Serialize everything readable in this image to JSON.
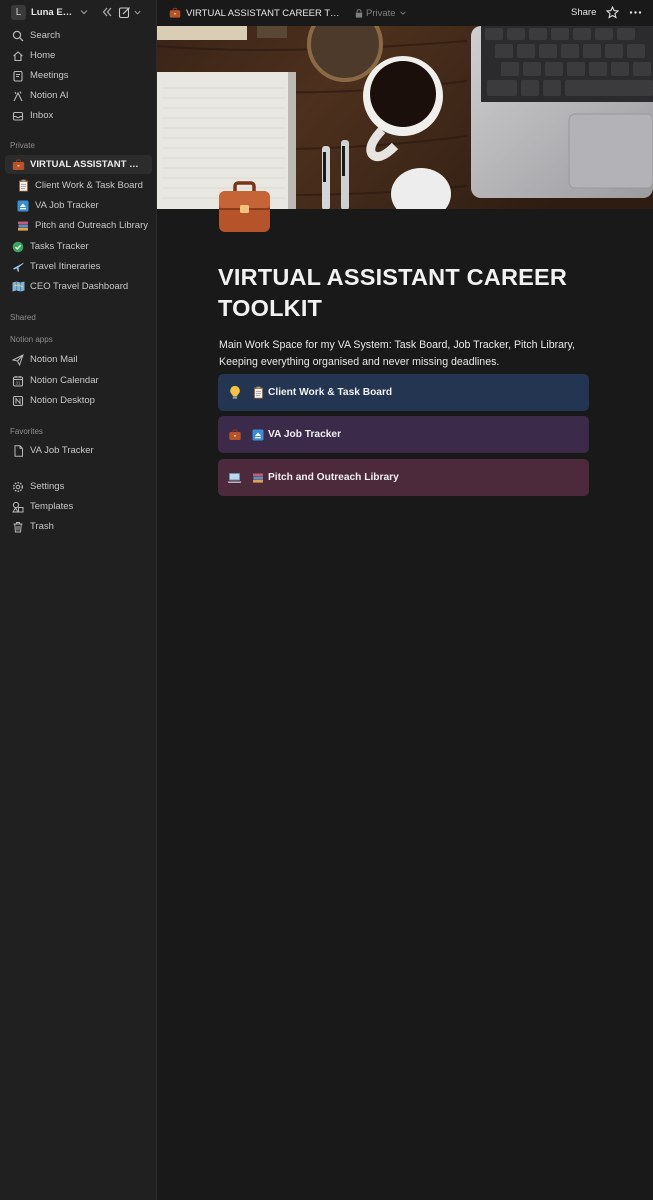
{
  "workspace": {
    "name": "Luna Esteves",
    "avatar_letter": "L"
  },
  "sidebar": {
    "top_items": [
      {
        "label": "Search",
        "icon": "search-icon"
      },
      {
        "label": "Home",
        "icon": "home-icon"
      },
      {
        "label": "Meetings",
        "icon": "meetings-icon"
      },
      {
        "label": "Notion AI",
        "icon": "notion-ai-icon"
      },
      {
        "label": "Inbox",
        "icon": "inbox-icon"
      }
    ],
    "private_label": "Private",
    "private_items": [
      {
        "label": "VIRTUAL ASSISTANT CAREER TOOLKIT",
        "icon": "briefcase-icon",
        "active": true
      },
      {
        "label": "Client Work & Task Board",
        "icon": "clipboard-icon"
      },
      {
        "label": "VA Job Tracker",
        "icon": "eject-icon"
      },
      {
        "label": "Pitch and Outreach Library",
        "icon": "books-icon"
      },
      {
        "label": "Tasks Tracker",
        "icon": "check-circle-icon"
      },
      {
        "label": "Travel Itineraries",
        "icon": "airplane-icon"
      },
      {
        "label": "CEO Travel Dashboard",
        "icon": "map-icon"
      }
    ],
    "shared_label": "Shared",
    "apps_label": "Notion apps",
    "app_items": [
      {
        "label": "Notion Mail",
        "icon": "send-icon"
      },
      {
        "label": "Notion Calendar",
        "icon": "calendar-icon"
      },
      {
        "label": "Notion Desktop",
        "icon": "desktop-icon"
      }
    ],
    "favorites_label": "Favorites",
    "favorite_items": [
      {
        "label": "VA Job Tracker",
        "icon": "page-icon"
      }
    ],
    "bottom_items": [
      {
        "label": "Settings",
        "icon": "gear-icon"
      },
      {
        "label": "Templates",
        "icon": "templates-icon"
      },
      {
        "label": "Trash",
        "icon": "trash-icon"
      }
    ]
  },
  "topbar": {
    "title": "VIRTUAL ASSISTANT CAREER TOOLKIT",
    "privacy": "Private",
    "share_label": "Share"
  },
  "page": {
    "title": "VIRTUAL ASSISTANT CAREER TOOLKIT",
    "description": "Main Work Space for my VA System: Task Board, Job Tracker, Pitch Library, Keeping everything organised and never missing deadlines.",
    "callouts": [
      {
        "label": "Client Work & Task Board",
        "icon": "lightbulb-icon",
        "link_icon": "clipboard-icon",
        "color": "#233550"
      },
      {
        "label": "VA Job Tracker",
        "icon": "briefcase-icon",
        "link_icon": "eject-icon",
        "color": "#3b2a49"
      },
      {
        "label": "Pitch and Outreach Library",
        "icon": "laptop-icon",
        "link_icon": "books-icon",
        "color": "#4d2a3b"
      }
    ]
  },
  "colors": {
    "sidebar_bg": "#202020",
    "page_bg": "#191919",
    "active_item": "#2c2c2c",
    "briefcase": "#b5542a"
  }
}
